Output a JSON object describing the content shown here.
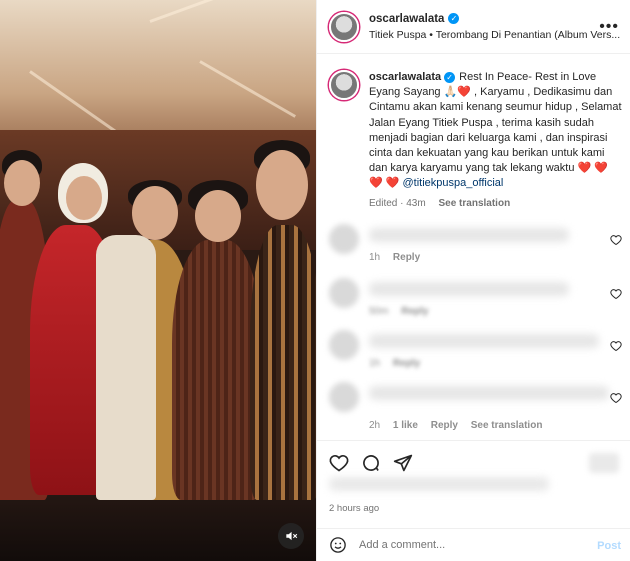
{
  "header": {
    "username": "oscarlawalata",
    "audio": "Titiek Puspa • Terombang Di Penantian (Album Vers...",
    "more_icon": "more-horizontal-icon"
  },
  "caption": {
    "username": "oscarlawalata",
    "text_1": "Rest In Peace- Rest in Love Eyang Sayang 🙏🏻❤️ , Karyamu , Dedikasimu dan Cintamu akan kami kenang seumur hidup , Selamat Jalan Eyang Titiek Puspa , terima kasih sudah menjadi bagian dari keluarga kami , dan inspirasi cinta dan kekuatan yang kau berikan untuk kami dan karya karyamu yang tak lekang waktu ❤️ ❤️ ❤️ ❤️",
    "mention": "@titiekpuspa_official",
    "edited": "Edited · 43m",
    "see_translation": "See translation"
  },
  "comments": [
    {
      "time": "1h",
      "reply": "Reply",
      "likes": "",
      "see_translation": ""
    },
    {
      "time": "50m",
      "reply": "Reply",
      "likes": "",
      "see_translation": ""
    },
    {
      "time": "1h",
      "reply": "Reply",
      "likes": "",
      "see_translation": ""
    },
    {
      "time": "2h",
      "reply": "Reply",
      "likes": "1 like",
      "see_translation": "See translation"
    }
  ],
  "footer": {
    "time_ago": "2 hours ago",
    "add_comment_placeholder": "Add a comment...",
    "post_label": "Post"
  },
  "colors": {
    "verified": "#0095f6",
    "link": "#00376b",
    "muted": "#737373",
    "post_disabled": "#b3dbff"
  }
}
